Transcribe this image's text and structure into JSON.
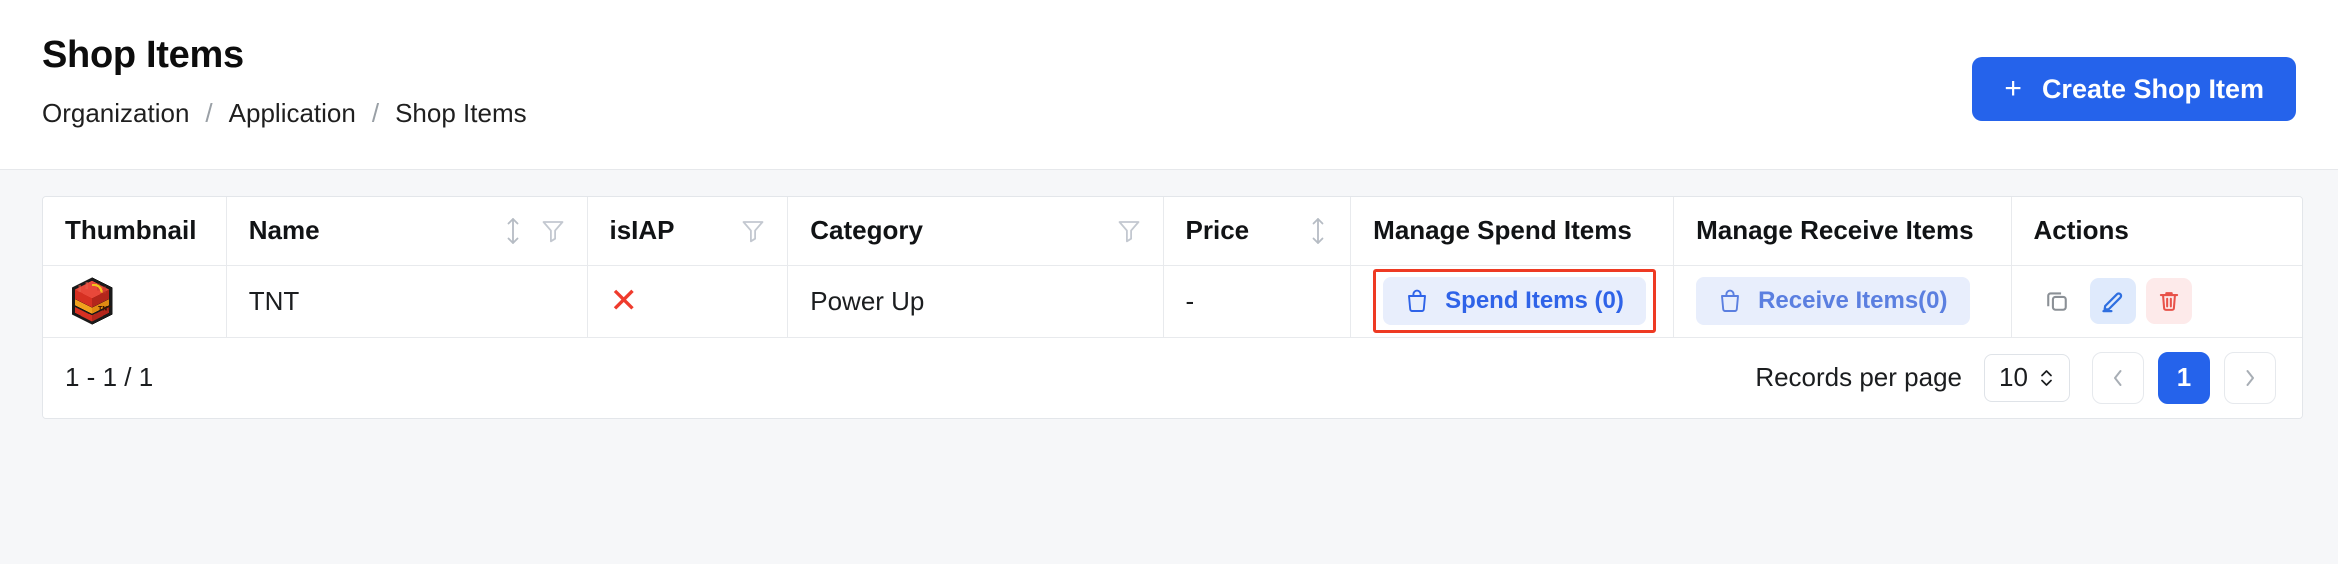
{
  "header": {
    "title": "Shop Items",
    "breadcrumb": [
      {
        "label": "Organization"
      },
      {
        "label": "Application"
      },
      {
        "label": "Shop Items"
      }
    ],
    "separator": "/",
    "create_button": {
      "label": "Create Shop Item",
      "icon": "plus-icon",
      "plus": "+",
      "color": "#2563eb"
    }
  },
  "table": {
    "columns": [
      {
        "key": "thumbnail",
        "label": "Thumbnail",
        "sortable": false,
        "filterable": false
      },
      {
        "key": "name",
        "label": "Name",
        "sortable": true,
        "filterable": true
      },
      {
        "key": "isiap",
        "label": "isIAP",
        "sortable": false,
        "filterable": true
      },
      {
        "key": "category",
        "label": "Category",
        "sortable": false,
        "filterable": true
      },
      {
        "key": "price",
        "label": "Price",
        "sortable": true,
        "filterable": false
      },
      {
        "key": "spend",
        "label": "Manage Spend Items",
        "sortable": false,
        "filterable": false
      },
      {
        "key": "receive",
        "label": "Manage Receive Items",
        "sortable": false,
        "filterable": false
      },
      {
        "key": "actions",
        "label": "Actions",
        "sortable": false,
        "filterable": false
      }
    ],
    "rows": [
      {
        "thumbnail_alt": "tnt-block-thumbnail",
        "name": "TNT",
        "isiap": false,
        "isiap_glyph": "✕",
        "category": "Power Up",
        "price": "-",
        "spend_label": "Spend Items (0)",
        "spend_icon": "shopping-bag-icon",
        "spend_highlighted": true,
        "receive_label": "Receive Items(0)",
        "receive_icon": "shopping-bag-icon",
        "actions": [
          {
            "name": "copy",
            "icon": "copy-icon"
          },
          {
            "name": "edit",
            "icon": "edit-pencil-icon"
          },
          {
            "name": "delete",
            "icon": "trash-icon"
          }
        ]
      }
    ]
  },
  "footer": {
    "record_range": "1 - 1 / 1",
    "records_per_page_label": "Records per page",
    "records_per_page_value": "10",
    "prev_label": "‹",
    "next_label": "›",
    "pages": [
      {
        "label": "1",
        "active": true
      }
    ]
  },
  "colors": {
    "accent": "#2563eb",
    "pill_bg": "#e8eefc",
    "pill_text": "#2f63e8",
    "highlight_border": "#ee3a23",
    "danger": "#ef3b2d",
    "page_bg": "#f6f7f9"
  }
}
